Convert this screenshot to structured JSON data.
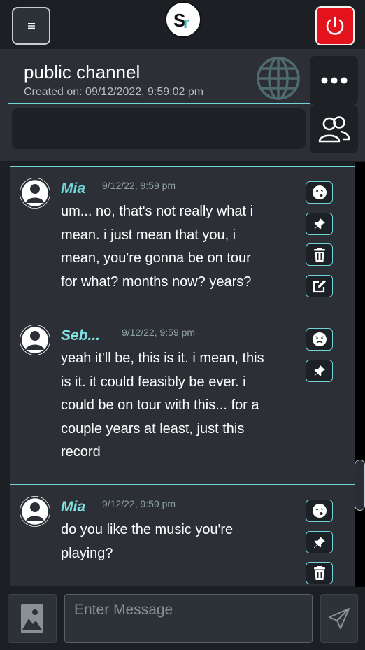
{
  "header": {
    "menu_icon": "hamburger-icon",
    "logo_text": "Sr",
    "power_icon": "power-icon",
    "power_color": "#e3121b"
  },
  "channel": {
    "title": "public channel",
    "created": "Created on: 09/12/2022, 9:59:02 pm",
    "globe_icon": "globe-icon",
    "more_icon": "more-dots-icon",
    "members_icon": "users-icon",
    "accent_color": "#6ed6d9"
  },
  "messages": [
    {
      "author": "Mia",
      "time": "9/12/22, 9:59 pm",
      "lines": [
        "um... no, that's not really what i",
        "mean. i just mean that you, i",
        "mean, you're gonna be on tour",
        "for what? months now? years?"
      ],
      "actions": [
        "react-icon",
        "pin-icon",
        "delete-icon",
        "edit-icon"
      ]
    },
    {
      "author": "Seb...",
      "time": "9/12/22, 9:59 pm",
      "lines": [
        "yeah it'll be, this is it. i mean, this",
        "is it. it could feasibly be ever. i",
        "could be on tour with this... for a",
        "couple years at least, just this",
        "record"
      ],
      "actions": [
        "react-icon",
        "pin-icon"
      ]
    },
    {
      "author": "Mia",
      "time": "9/12/22, 9:59 pm",
      "lines": [
        "do you like the music you're",
        "playing?"
      ],
      "actions": [
        "react-icon",
        "pin-icon",
        "delete-icon"
      ]
    }
  ],
  "composer": {
    "placeholder": "Enter Message",
    "image_icon": "image-icon",
    "send_icon": "send-icon"
  }
}
